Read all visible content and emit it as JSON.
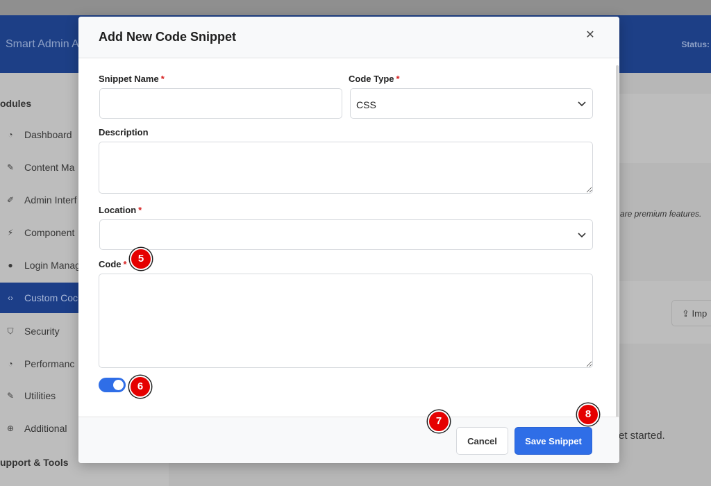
{
  "background": {
    "brand": "Smart Admin A",
    "status": "Status:",
    "sidebar": {
      "modules_heading": "odules",
      "items": [
        {
          "label": "Dashboard",
          "icon": "gauge-icon"
        },
        {
          "label": "Content Ma",
          "icon": "pin-icon"
        },
        {
          "label": "Admin Interf",
          "icon": "brush-icon"
        },
        {
          "label": "Component",
          "icon": "plug-icon"
        },
        {
          "label": "Login Manag",
          "icon": "user-icon"
        },
        {
          "label": "Custom Coc",
          "icon": "code-icon",
          "active": true
        },
        {
          "label": "Security",
          "icon": "shield-icon"
        },
        {
          "label": "Performanc",
          "icon": "gauge-icon"
        },
        {
          "label": "Utilities",
          "icon": "wrench-icon"
        },
        {
          "label": "Additional",
          "icon": "plus-circle-icon"
        }
      ],
      "support_heading": "upport & Tools"
    },
    "premium_note": "are premium features.",
    "import_button": "Imp",
    "get_started": "et started."
  },
  "modal": {
    "title": "Add New Code Snippet",
    "close_icon": "close-icon",
    "snippet_name": {
      "label": "Snippet Name",
      "required": "*",
      "value": ""
    },
    "code_type": {
      "label": "Code Type",
      "required": "*",
      "value": "CSS"
    },
    "description": {
      "label": "Description",
      "value": ""
    },
    "location": {
      "label": "Location",
      "required": "*",
      "value": ""
    },
    "code": {
      "label": "Code",
      "required": "*",
      "value": ""
    },
    "toggle": {
      "state": "on"
    },
    "cancel_label": "Cancel",
    "save_label": "Save Snippet"
  },
  "markers": [
    "5",
    "6",
    "7",
    "8"
  ],
  "colors": {
    "accent": "#2f6ee7",
    "required": "#d62020",
    "marker": "#e50000",
    "header_bg": "#1d3f86"
  }
}
